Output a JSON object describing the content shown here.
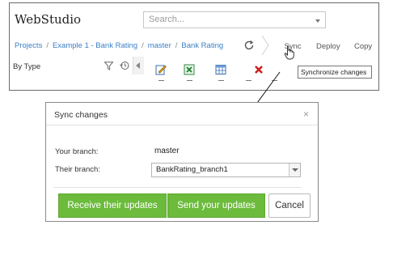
{
  "app": {
    "title": "WebStudio",
    "search_placeholder": "Search..."
  },
  "breadcrumb": [
    "Projects",
    "Example 1 - Bank Rating",
    "master",
    "Bank Rating"
  ],
  "toolbar": {
    "sync_label": "Sync",
    "deploy_label": "Deploy",
    "copy_label": "Copy",
    "filter_label": "By Type",
    "tooltip": "Synchronize changes"
  },
  "icons": [
    "refresh-icon",
    "filter-icon",
    "history-icon",
    "edit-icon",
    "excel-icon",
    "table-icon",
    "delete-icon",
    "close-icon",
    "hand-cursor-icon"
  ],
  "dialog": {
    "title": "Sync changes",
    "close_symbol": "×",
    "your_branch_label": "Your branch:",
    "your_branch_value": "master",
    "their_branch_label": "Their branch:",
    "their_branch_value": "BankRating_branch1",
    "receive_label": "Receive their updates",
    "send_label": "Send your updates",
    "cancel_label": "Cancel"
  },
  "colors": {
    "accent_green": "#6cbb3c",
    "link_blue": "#3b7fc4",
    "delete_red": "#cc1f1f"
  }
}
